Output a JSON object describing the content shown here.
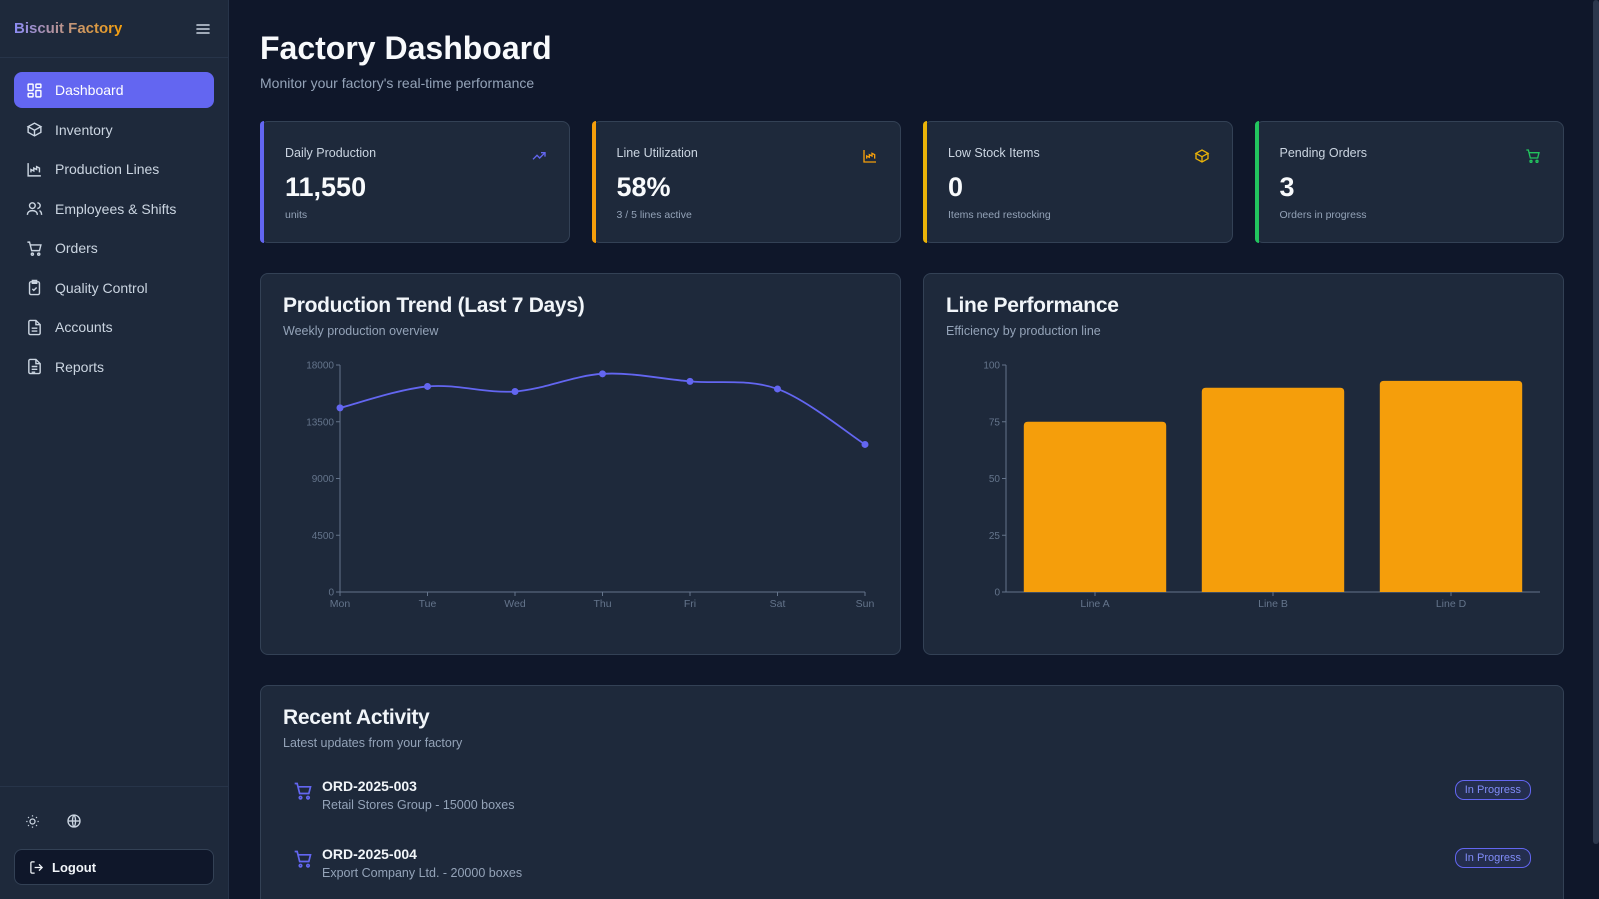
{
  "app": {
    "brand": "Biscuit Factory"
  },
  "sidebar": {
    "items": [
      {
        "label": "Dashboard",
        "icon": "dashboard-icon",
        "active": true
      },
      {
        "label": "Inventory",
        "icon": "box-icon"
      },
      {
        "label": "Production Lines",
        "icon": "factory-icon"
      },
      {
        "label": "Employees & Shifts",
        "icon": "users-icon"
      },
      {
        "label": "Orders",
        "icon": "cart-icon"
      },
      {
        "label": "Quality Control",
        "icon": "clipboard-check-icon"
      },
      {
        "label": "Accounts",
        "icon": "file-icon"
      },
      {
        "label": "Reports",
        "icon": "report-icon"
      }
    ],
    "logout_label": "Logout"
  },
  "header": {
    "title": "Factory Dashboard",
    "subtitle": "Monitor your factory's real-time performance"
  },
  "stats": [
    {
      "label": "Daily Production",
      "value": "11,550",
      "foot": "units",
      "accent": "#6366f1",
      "icon": "trending-up-icon"
    },
    {
      "label": "Line Utilization",
      "value": "58%",
      "foot": "3 / 5 lines active",
      "accent": "#f59e0b",
      "icon": "factory-icon"
    },
    {
      "label": "Low Stock Items",
      "value": "0",
      "foot": "Items need restocking",
      "accent": "#eab308",
      "icon": "box-icon"
    },
    {
      "label": "Pending Orders",
      "value": "3",
      "foot": "Orders in progress",
      "accent": "#22c55e",
      "icon": "cart-icon"
    }
  ],
  "trend": {
    "title": "Production Trend (Last 7 Days)",
    "subtitle": "Weekly production overview"
  },
  "performance": {
    "title": "Line Performance",
    "subtitle": "Efficiency by production line"
  },
  "activity": {
    "title": "Recent Activity",
    "subtitle": "Latest updates from your factory",
    "items": [
      {
        "title": "ORD-2025-003",
        "desc": "Retail Stores Group - 15000 boxes",
        "status": "In Progress"
      },
      {
        "title": "ORD-2025-004",
        "desc": "Export Company Ltd. - 20000 boxes",
        "status": "In Progress"
      }
    ]
  },
  "chart_data": [
    {
      "type": "line",
      "categories": [
        "Mon",
        "Tue",
        "Wed",
        "Thu",
        "Fri",
        "Sat",
        "Sun"
      ],
      "series": [
        {
          "values": [
            14600,
            16300,
            15900,
            17300,
            16700,
            16100,
            11700
          ]
        }
      ],
      "yticks": [
        "0",
        "4500",
        "9000",
        "13500",
        "18000"
      ],
      "ylim": [
        0,
        18000
      ],
      "color": "#6366f1"
    },
    {
      "type": "bar",
      "categories": [
        "Line A",
        "Line B",
        "Line D"
      ],
      "values": [
        75,
        90,
        93
      ],
      "yticks": [
        "0",
        "25",
        "50",
        "75",
        "100"
      ],
      "ylim": [
        0,
        100
      ],
      "color": "#f59e0b"
    }
  ]
}
